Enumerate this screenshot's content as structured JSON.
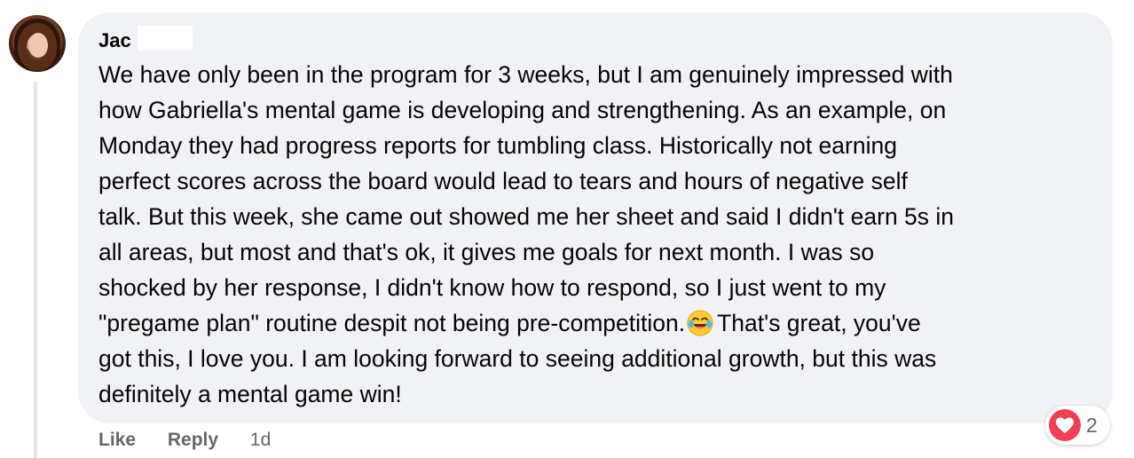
{
  "comment": {
    "author": "Jac",
    "lines": [
      "We have only been in the program for 3 weeks, but I am genuinely impressed with",
      "how Gabriella's mental game is developing and strengthening. As an example, on",
      "Monday they had progress reports for tumbling class. Historically not earning",
      "perfect scores across the board would lead to tears and hours of negative self",
      "talk. But this week, she came out showed me her sheet and said I didn't earn 5s in",
      "all areas, but most and that's ok, it gives me goals for next month. I was so",
      "shocked by her response, I didn't know how to respond, so I just went to my"
    ],
    "line8_before_emoji": "\"pregame plan\" routine despit not being pre-competition.",
    "emoji": "laughing-with-tears-emoji",
    "line8_after_emoji": "That's great, you've",
    "lines_end": [
      "got this, I love you. I am looking forward to seeing additional growth, but this was",
      "definitely a mental game win!"
    ]
  },
  "actions": {
    "like_label": "Like",
    "reply_label": "Reply",
    "timestamp": "1d"
  },
  "reactions": {
    "icon": "heart-icon",
    "color": "#f33e58",
    "count": "2"
  },
  "colors": {
    "bubble": "#f0f2f5",
    "text": "#050505",
    "secondary": "#65676b"
  }
}
